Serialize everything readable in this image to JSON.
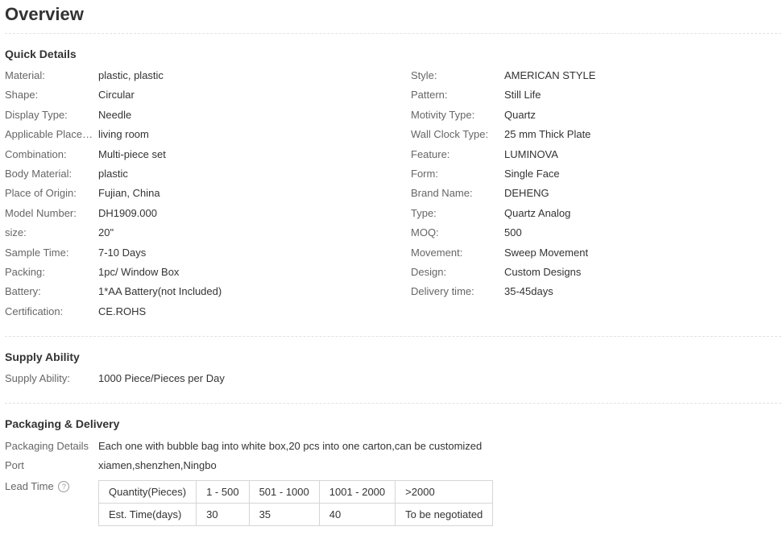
{
  "title": "Overview",
  "quick_details": {
    "heading": "Quick Details",
    "left": [
      {
        "label": "Material:",
        "value": "plastic, plastic"
      },
      {
        "label": "Shape:",
        "value": "Circular"
      },
      {
        "label": "Display Type:",
        "value": "Needle"
      },
      {
        "label": "Applicable Placem...",
        "value": "living room"
      },
      {
        "label": "Combination:",
        "value": "Multi-piece set"
      },
      {
        "label": "Body Material:",
        "value": "plastic"
      },
      {
        "label": "Place of Origin:",
        "value": "Fujian, China"
      },
      {
        "label": "Model Number:",
        "value": "DH1909.000"
      },
      {
        "label": "size:",
        "value": "20\""
      },
      {
        "label": "Sample Time:",
        "value": "7-10 Days"
      },
      {
        "label": "Packing:",
        "value": "1pc/ Window Box"
      },
      {
        "label": "Battery:",
        "value": "1*AA Battery(not Included)"
      },
      {
        "label": "Certification:",
        "value": "CE.ROHS"
      }
    ],
    "right": [
      {
        "label": "Style:",
        "value": "AMERICAN STYLE"
      },
      {
        "label": "Pattern:",
        "value": "Still Life"
      },
      {
        "label": "Motivity Type:",
        "value": "Quartz"
      },
      {
        "label": "Wall Clock Type:",
        "value": "25 mm Thick Plate"
      },
      {
        "label": "Feature:",
        "value": "LUMINOVA"
      },
      {
        "label": "Form:",
        "value": "Single Face"
      },
      {
        "label": "Brand Name:",
        "value": "DEHENG"
      },
      {
        "label": "Type:",
        "value": "Quartz Analog"
      },
      {
        "label": "MOQ:",
        "value": "500"
      },
      {
        "label": "Movement:",
        "value": "Sweep Movement"
      },
      {
        "label": "Design:",
        "value": "Custom Designs"
      },
      {
        "label": "Delivery time:",
        "value": "35-45days"
      }
    ]
  },
  "supply": {
    "heading": "Supply Ability",
    "label": "Supply Ability:",
    "value": "1000 Piece/Pieces per Day"
  },
  "packaging": {
    "heading": "Packaging & Delivery",
    "details_label": "Packaging Details",
    "details_value": "Each one with bubble bag into white box,20 pcs into one carton,can be customized",
    "port_label": "Port",
    "port_value": "xiamen,shenzhen,Ningbo",
    "lead_label": "Lead Time",
    "help_glyph": "?",
    "lead_table": {
      "row1": [
        "Quantity(Pieces)",
        "1 - 500",
        "501 - 1000",
        "1001 - 2000",
        ">2000"
      ],
      "row2": [
        "Est. Time(days)",
        "30",
        "35",
        "40",
        "To be negotiated"
      ]
    }
  }
}
